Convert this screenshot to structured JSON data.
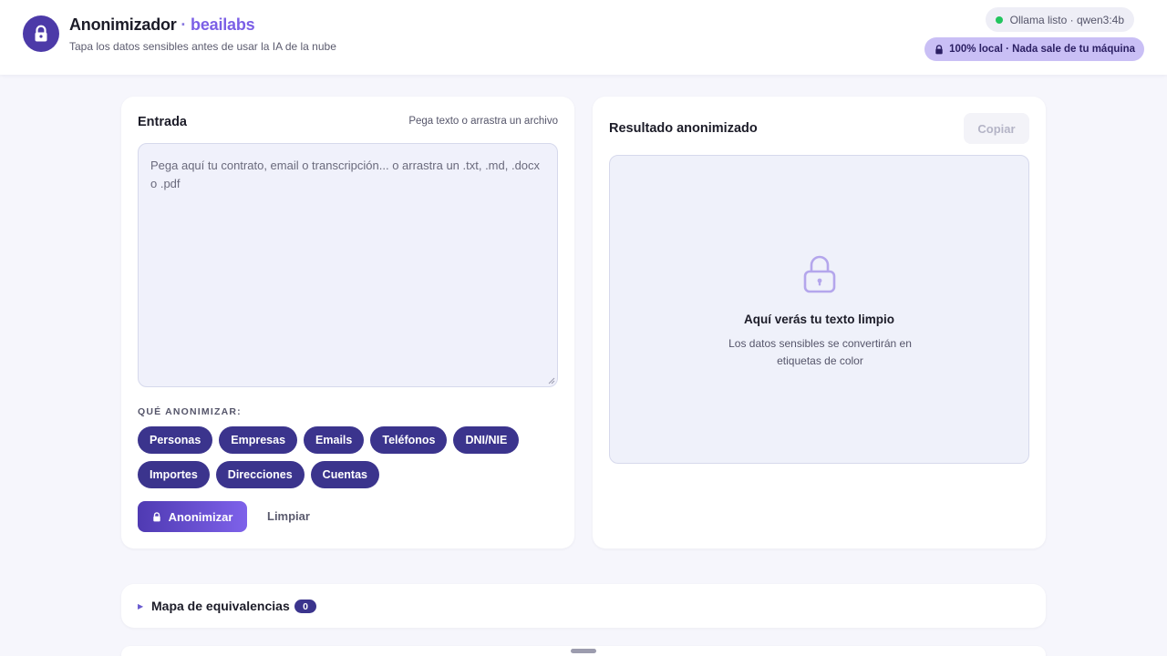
{
  "header": {
    "title": "Anonimizador",
    "separator": "·",
    "brand": "beailabs",
    "subtitle": "Tapa los datos sensibles antes de usar la IA de la nube",
    "status_text": "Ollama listo · qwen3:4b",
    "status_color": "#22c55e",
    "local_badge": "100% local · Nada sale de tu máquina"
  },
  "input": {
    "title": "Entrada",
    "hint": "Pega texto o arrastra un archivo",
    "placeholder": "Pega aquí tu contrato, email o transcripción... o arrastra un .txt, .md, .docx o .pdf",
    "section_label": "QUÉ ANONIMIZAR:",
    "chips": [
      "Personas",
      "Empresas",
      "Emails",
      "Teléfonos",
      "DNI/NIE",
      "Importes",
      "Direcciones",
      "Cuentas"
    ],
    "anonymize_button": "Anonimizar",
    "clear_button": "Limpiar"
  },
  "output": {
    "title": "Resultado anonimizado",
    "copy_button": "Copiar",
    "empty_title": "Aquí verás tu texto limpio",
    "empty_text": "Los datos sensibles se convertirán en etiquetas de color"
  },
  "map": {
    "title": "Mapa de equivalencias",
    "count": "0"
  },
  "colors": {
    "accent": "#3b348d",
    "brand": "#7b5fe6",
    "local_badge_bg": "#c9bff5"
  }
}
